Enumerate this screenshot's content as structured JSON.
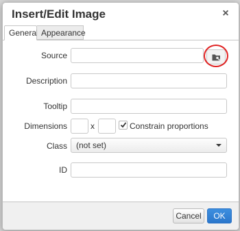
{
  "dialog": {
    "title": "Insert/Edit Image",
    "close_glyph": "×"
  },
  "tabs": [
    {
      "label": "General",
      "active": true
    },
    {
      "label": "Appearance",
      "active": false
    }
  ],
  "fields": {
    "source": {
      "label": "Source",
      "value": ""
    },
    "description": {
      "label": "Description",
      "value": ""
    },
    "tooltip": {
      "label": "Tooltip",
      "value": ""
    },
    "dimensions": {
      "label": "Dimensions",
      "width": "",
      "height": "",
      "separator": "x",
      "constrain_label": "Constrain proportions",
      "constrain_checked": true
    },
    "class": {
      "label": "Class",
      "value": "(not set)"
    },
    "id": {
      "label": "ID",
      "value": ""
    }
  },
  "icons": {
    "browse": "folder-search-icon",
    "close": "close-icon",
    "check": "checkmark-icon",
    "dropdown": "chevron-down-icon"
  },
  "footer": {
    "cancel_label": "Cancel",
    "ok_label": "OK"
  },
  "colors": {
    "ok_button": "#2b77cc",
    "highlight": "#e02020"
  }
}
